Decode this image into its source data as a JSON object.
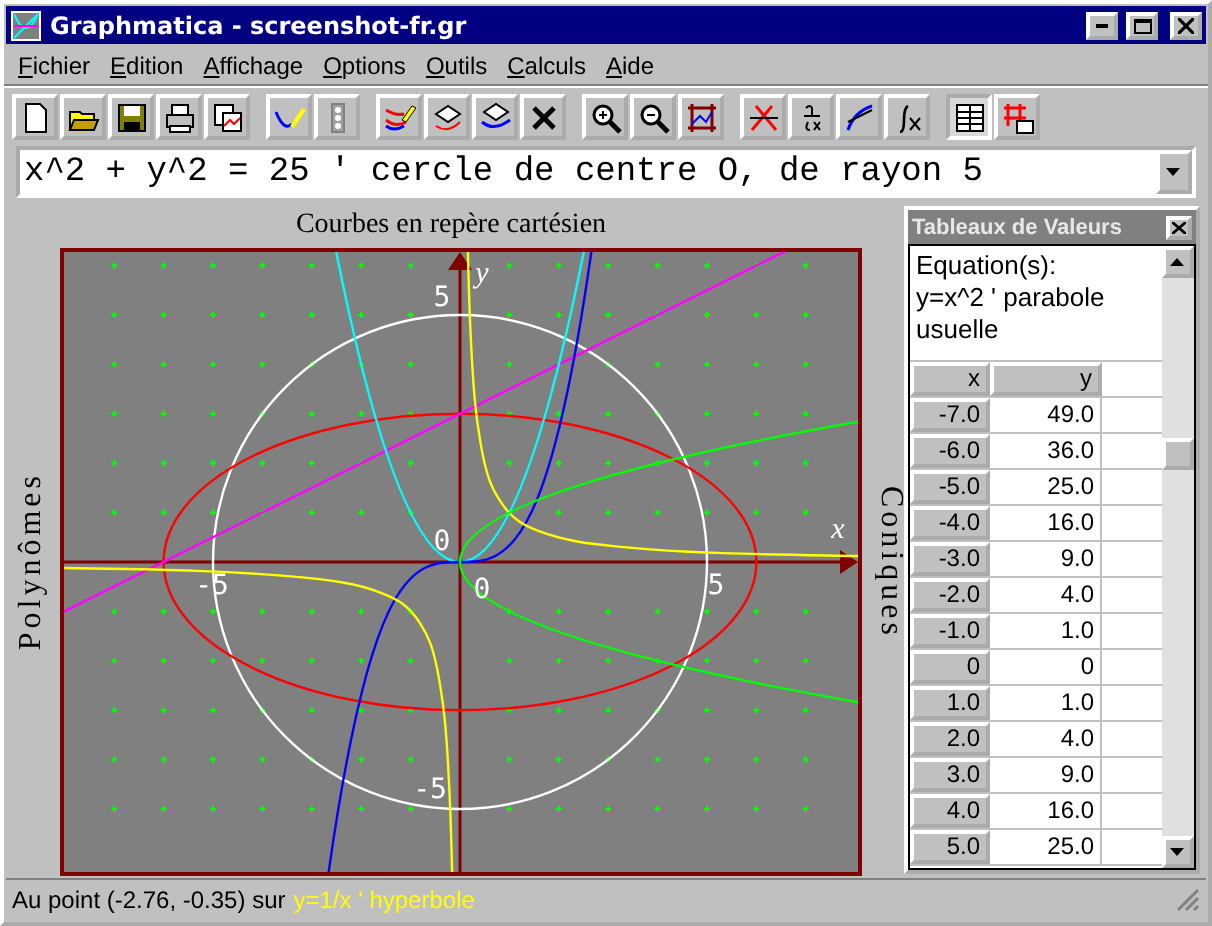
{
  "window": {
    "title": "Graphmatica - screenshot-fr.gr"
  },
  "menu": [
    "Fichier",
    "Edition",
    "Affichage",
    "Options",
    "Outils",
    "Calculs",
    "Aide"
  ],
  "toolbar": [
    [
      {
        "kind": "new",
        "pressed": false
      },
      {
        "kind": "open",
        "pressed": false
      },
      {
        "kind": "save",
        "pressed": false
      },
      {
        "kind": "print",
        "pressed": false
      },
      {
        "kind": "copy",
        "pressed": false
      }
    ],
    [
      {
        "kind": "define",
        "pressed": false
      },
      {
        "kind": "lights",
        "pressed": false
      }
    ],
    [
      {
        "kind": "redraw",
        "pressed": false
      },
      {
        "kind": "erase",
        "pressed": false
      },
      {
        "kind": "erase-all",
        "pressed": false
      },
      {
        "kind": "delete",
        "pressed": false
      }
    ],
    [
      {
        "kind": "zoom-in",
        "pressed": false
      },
      {
        "kind": "zoom-out",
        "pressed": false
      },
      {
        "kind": "grid",
        "pressed": false
      }
    ],
    [
      {
        "kind": "intersect",
        "pressed": false
      },
      {
        "kind": "derivative",
        "pressed": false
      },
      {
        "kind": "tangent",
        "pressed": false
      },
      {
        "kind": "integral",
        "pressed": false
      }
    ],
    [
      {
        "kind": "table",
        "pressed": true
      },
      {
        "kind": "grid-table",
        "pressed": false
      }
    ]
  ],
  "equation_field": {
    "value": "x^2 + y^2 = 25 ' cercle de centre O, de rayon 5"
  },
  "graph": {
    "title": "Courbes en repère cartésien",
    "left_label": "Polynômes",
    "right_label": "Coniques",
    "axis_labels": [
      {
        "kind": "y-name",
        "text": "y"
      },
      {
        "kind": "y-top",
        "text": "5"
      },
      {
        "kind": "origin-top",
        "text": "0"
      },
      {
        "kind": "x-name",
        "text": "x"
      },
      {
        "kind": "x-left",
        "text": "-5"
      },
      {
        "kind": "origin-bottom",
        "text": "0"
      },
      {
        "kind": "x-right",
        "text": "5"
      },
      {
        "kind": "y-bottom",
        "text": "-5"
      }
    ],
    "curves": [
      {
        "kind": "circle",
        "color": "#ffffff"
      },
      {
        "kind": "ellipse",
        "color": "#ff0000"
      },
      {
        "kind": "line",
        "color": "#ff00ff"
      },
      {
        "kind": "parabola",
        "color": "#00ffff"
      },
      {
        "kind": "cubic",
        "color": "#0000ff"
      },
      {
        "kind": "hyperbola",
        "color": "#ffff00"
      },
      {
        "kind": "root",
        "color": "#00ff00"
      }
    ]
  },
  "values_table": {
    "title": "Tableaux de Valeurs",
    "equation_lines": [
      "Equation(s):",
      "y=x^2 ' parabole usuelle"
    ],
    "columns": [
      "x",
      "y"
    ],
    "rows": [
      [
        "-7.0",
        "49.0"
      ],
      [
        "-6.0",
        "36.0"
      ],
      [
        "-5.0",
        "25.0"
      ],
      [
        "-4.0",
        "16.0"
      ],
      [
        "-3.0",
        "9.0"
      ],
      [
        "-2.0",
        "4.0"
      ],
      [
        "-1.0",
        "1.0"
      ],
      [
        "0",
        "0"
      ],
      [
        "1.0",
        "1.0"
      ],
      [
        "2.0",
        "4.0"
      ],
      [
        "3.0",
        "9.0"
      ],
      [
        "4.0",
        "16.0"
      ],
      [
        "5.0",
        "25.0"
      ]
    ]
  },
  "status_bar": {
    "text": "Au point (-2.76, -0.35) sur",
    "curve": "y=1/x ' hyperbole"
  }
}
